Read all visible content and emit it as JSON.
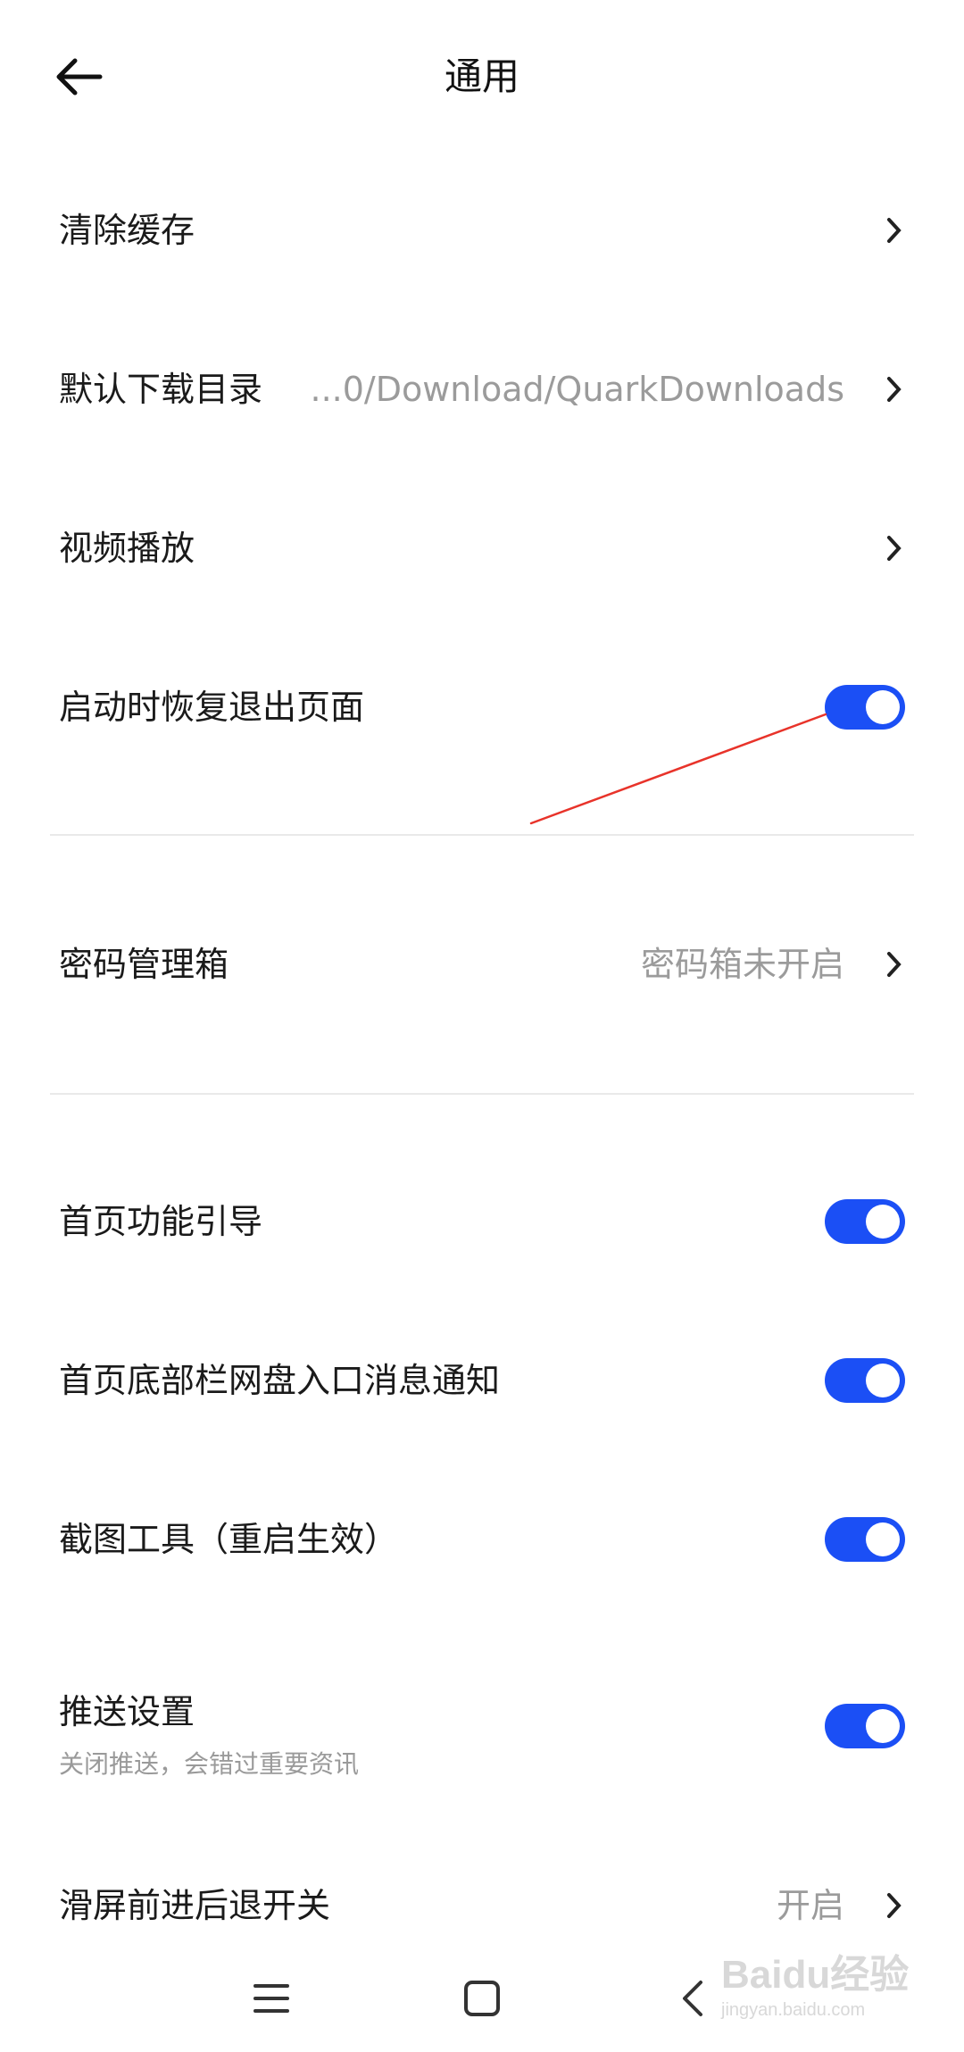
{
  "header": {
    "title": "通用",
    "back_icon": "arrow-left-icon"
  },
  "settings": [
    {
      "label": "清除缓存",
      "value": "",
      "control": "chevron"
    },
    {
      "label": "默认下载目录",
      "value": "...0/Download/QuarkDownloads",
      "control": "chevron"
    },
    {
      "label": "视频播放",
      "value": "",
      "control": "chevron"
    },
    {
      "label": "启动时恢复退出页面",
      "value": "",
      "control": "toggle",
      "on": true
    },
    {
      "label": "密码管理箱",
      "value": "密码箱未开启",
      "control": "chevron"
    },
    {
      "label": "首页功能引导",
      "value": "",
      "control": "toggle",
      "on": true
    },
    {
      "label": "首页底部栏网盘入口消息通知",
      "value": "",
      "control": "toggle",
      "on": true
    },
    {
      "label": "截图工具（重启生效）",
      "value": "",
      "control": "toggle",
      "on": true
    },
    {
      "label": "推送设置",
      "sub": "关闭推送，会错过重要资讯",
      "control": "toggle",
      "on": true
    },
    {
      "label": "滑屏前进后退开关",
      "value": "开启",
      "control": "chevron"
    }
  ],
  "navbar": {
    "menu_icon": "menu-icon",
    "home_icon": "home-square-icon",
    "back_icon": "chevron-left-icon"
  },
  "watermark": {
    "brand": "Baidu经验",
    "url": "jingyan.baidu.com"
  },
  "colors": {
    "toggle_on": "#1b4ff5",
    "annotation_line": "#e8332a",
    "text_secondary": "#9b9b9b"
  }
}
